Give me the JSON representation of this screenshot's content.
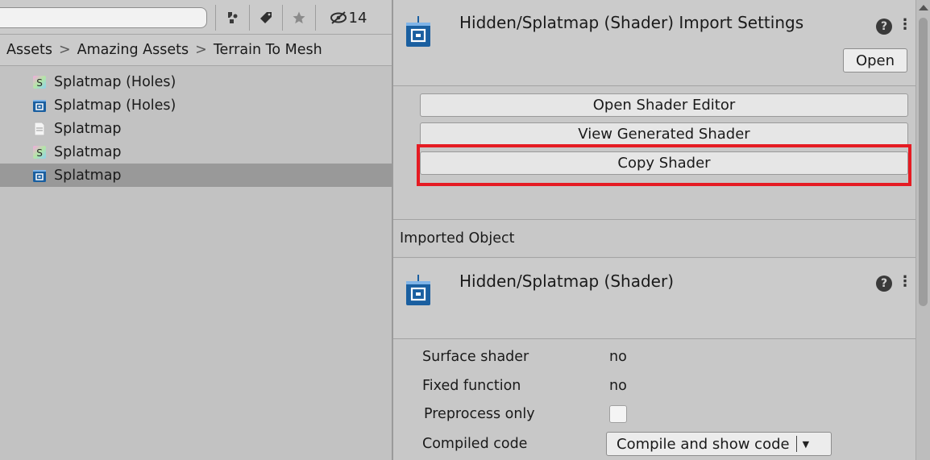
{
  "toolbar": {
    "search_value": "",
    "hidden_count": "14",
    "icons": [
      "filter-by-type-icon",
      "filter-by-label-icon",
      "favorites-star-icon",
      "hidden-packages-icon"
    ]
  },
  "breadcrumb": {
    "items": [
      "Assets",
      "Amazing Assets",
      "Terrain To Mesh"
    ],
    "separator": ">"
  },
  "assets": [
    {
      "label": "Splatmap (Holes)",
      "icon": "shader-graph-icon",
      "selected": false
    },
    {
      "label": "Splatmap (Holes)",
      "icon": "shader-icon",
      "selected": false
    },
    {
      "label": "Splatmap",
      "icon": "text-file-icon",
      "selected": false
    },
    {
      "label": "Splatmap",
      "icon": "shader-graph-icon",
      "selected": false
    },
    {
      "label": "Splatmap",
      "icon": "shader-icon",
      "selected": true
    }
  ],
  "inspector": {
    "header_title": "Hidden/Splatmap (Shader) Import Settings",
    "open_label": "Open",
    "buttons": {
      "open_shader_editor": "Open Shader Editor",
      "view_generated_shader": "View Generated Shader",
      "copy_shader": "Copy Shader"
    },
    "imported_object_label": "Imported Object",
    "object_title": "Hidden/Splatmap (Shader)",
    "properties": {
      "surface_shader": {
        "label": "Surface shader",
        "value": "no"
      },
      "fixed_function": {
        "label": "Fixed function",
        "value": "no"
      },
      "preprocess_only": {
        "label": "Preprocess only",
        "checked": false
      },
      "compiled_code": {
        "label": "Compiled code",
        "dropdown": "Compile and show code"
      }
    }
  },
  "colors": {
    "highlight": "#e51b23",
    "shader_icon_blue": "#1a5fa0",
    "selected_row": "#999999"
  }
}
